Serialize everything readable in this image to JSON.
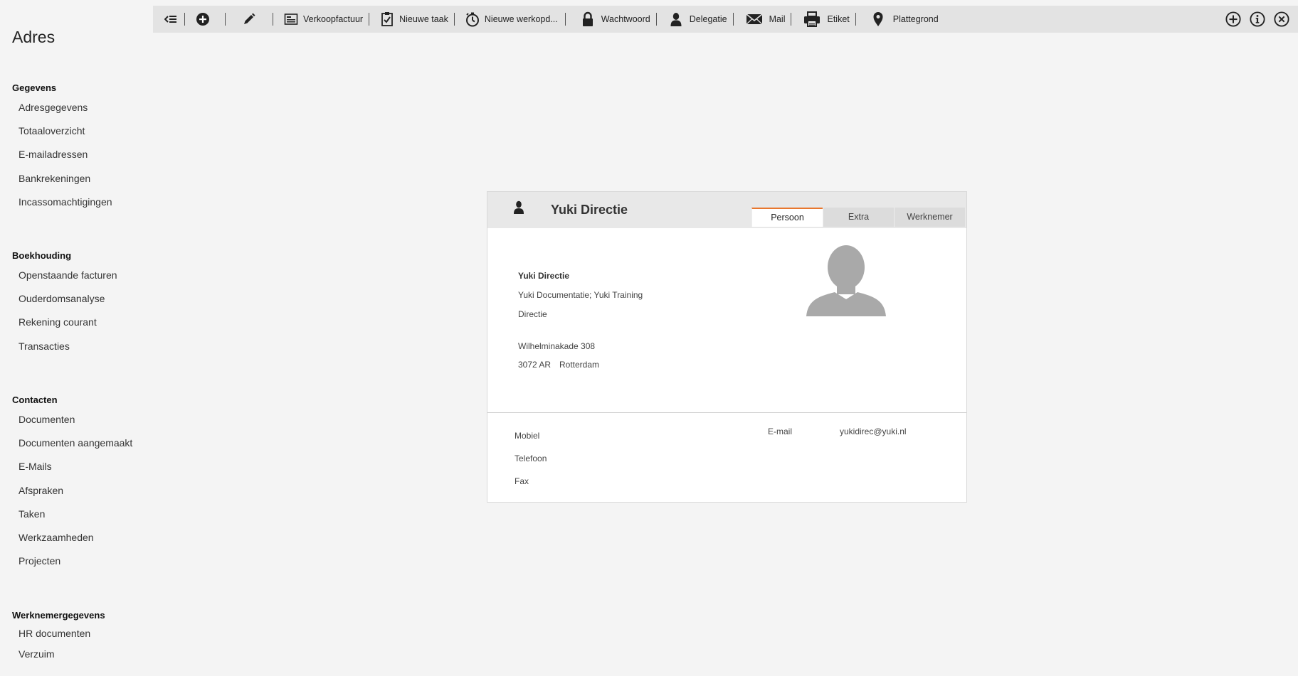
{
  "sidebar": {
    "title": "Adres",
    "sections": [
      {
        "header": "Gegevens",
        "items": [
          "Adresgegevens",
          "Totaaloverzicht",
          "E-mailadressen",
          "Bankrekeningen",
          "Incassomachtigingen"
        ]
      },
      {
        "header": "Boekhouding",
        "items": [
          "Openstaande facturen",
          "Ouderdomsanalyse",
          "Rekening courant",
          "Transacties"
        ]
      },
      {
        "header": "Contacten",
        "items": [
          "Documenten",
          "Documenten aangemaakt",
          "E-Mails",
          "Afspraken",
          "Taken",
          "Werkzaamheden",
          "Projecten"
        ]
      },
      {
        "header": "Werknemergegevens",
        "items": [
          "HR documenten",
          "Verzuim"
        ]
      }
    ]
  },
  "toolbar": {
    "verkoopfactuur": "Verkoopfactuur",
    "nieuwe_taak": "Nieuwe taak",
    "nieuwe_werkopdracht": "Nieuwe werkopd...",
    "wachtwoord": "Wachtwoord",
    "delegatie": "Delegatie",
    "mail": "Mail",
    "etiket": "Etiket",
    "plattegrond": "Plattegrond"
  },
  "card": {
    "name": "Yuki Directie",
    "tabs": [
      "Persoon",
      "Extra",
      "Werknemer"
    ],
    "active_tab": "Persoon",
    "person_name": "Yuki Directie",
    "companies": "Yuki Documentatie; Yuki Training",
    "function": "Directie",
    "street": "Wilhelminakade 308",
    "postcode": "3072 AR",
    "city": "Rotterdam",
    "mobiel_label": "Mobiel",
    "telefoon_label": "Telefoon",
    "fax_label": "Fax",
    "email_label": "E-mail",
    "email_value": "yukidirec@yuki.nl"
  },
  "colors": {
    "accent": "#e8772e",
    "background": "#f4f4f4",
    "toolbar": "#e3e3e3"
  }
}
